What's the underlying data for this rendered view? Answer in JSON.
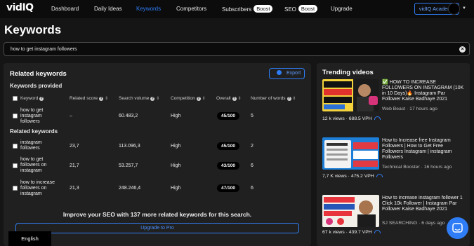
{
  "nav": {
    "logo": "vidIQ",
    "items": [
      "Dashboard",
      "Daily Ideas",
      "Keywords",
      "Competitors",
      "Subscribers",
      "SEO",
      "Upgrade"
    ],
    "boost_label": "Boost",
    "academy_label": "vidIQ Academy",
    "active_color": "#2f7df6"
  },
  "page_title": "Keywords",
  "search": {
    "value": "how to get instagram followers"
  },
  "related": {
    "title": "Related keywords",
    "export_label": "Export",
    "provided_label": "Keywords provided",
    "related_label": "Related keywords",
    "columns": [
      "Keyword",
      "Related score",
      "Search volume",
      "Competition",
      "Overall",
      "Number of words"
    ],
    "provided_rows": [
      {
        "keyword": "how to get instagram followers",
        "score": "–",
        "volume": "60.483,2",
        "competition": "High",
        "overall": "45/100",
        "words": "5"
      }
    ],
    "related_rows": [
      {
        "keyword": "instagram followers",
        "score": "23,7",
        "volume": "113.096,3",
        "competition": "High",
        "overall": "45/100",
        "words": "2"
      },
      {
        "keyword": "how to get followers on instagram",
        "score": "21,7",
        "volume": "53.257,7",
        "competition": "High",
        "overall": "43/100",
        "words": "6"
      },
      {
        "keyword": "how to increase followers on instagram",
        "score": "21,3",
        "volume": "248.246,4",
        "competition": "High",
        "overall": "47/100",
        "words": "6"
      }
    ],
    "upgrade_text": "Improve your SEO with 137 more related keywords for this search.",
    "upgrade_button": "Upgrade to Pro"
  },
  "language": "English",
  "trending": {
    "title": "Trending videos",
    "videos": [
      {
        "title": "✅ HOW TO INCREASE FOLLOWERS ON INSTAGRAM (10K in 10 Days)🔥 Instagram Par Follower Kaise Badhaye 2021",
        "channel": "Web Beast",
        "age": "17 hours ago",
        "views": "12 k views",
        "vph": "688.5 VPH"
      },
      {
        "title": "How to Increase free Instagram Followers | How to Get Free Followers Instagram | instagram Followers",
        "channel": "Technical Booster",
        "age": "16 hours ago",
        "views": "7,7 K views",
        "vph": "475.2 VPH"
      },
      {
        "title": "How to increase instagram follower 1 Click 10k Follower | Instagram Par Follower Kaise Badhaye 2021",
        "channel": "SJ SEARCHING",
        "age": "6 days ago",
        "views": "67 k views",
        "vph": "439.7 VPH"
      }
    ]
  }
}
